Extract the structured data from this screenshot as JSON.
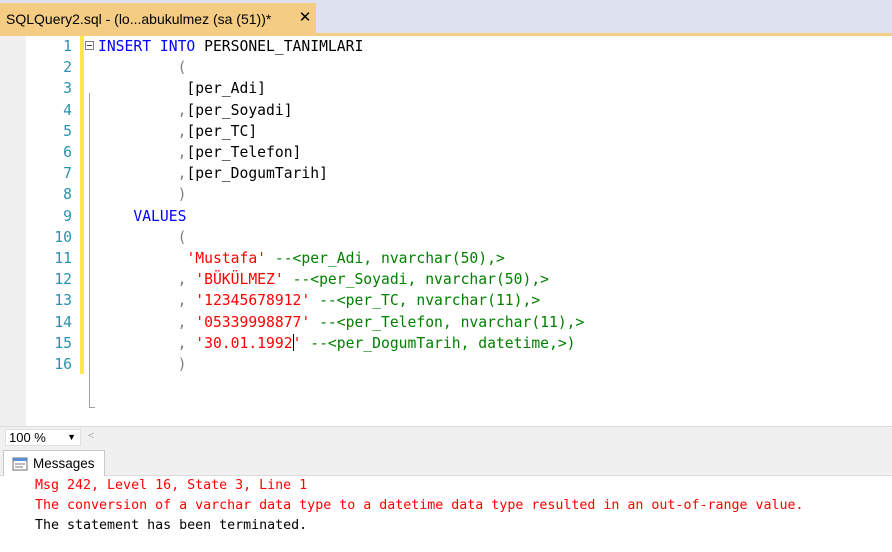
{
  "tab": {
    "title": "SQLQuery2.sql - (lo...abukulmez (sa (51))*",
    "close": "✕"
  },
  "editor": {
    "lines": [
      {
        "n": "1",
        "parts": [
          [
            "kw",
            "INSERT"
          ],
          [
            "plain",
            " "
          ],
          [
            "kw",
            "INTO"
          ],
          [
            "plain",
            " PERSONEL_TANIMLARI"
          ]
        ]
      },
      {
        "n": "2",
        "parts": [
          [
            "plain",
            "         "
          ],
          [
            "gray",
            "("
          ]
        ]
      },
      {
        "n": "3",
        "parts": [
          [
            "plain",
            "          [per_Adi]"
          ]
        ]
      },
      {
        "n": "4",
        "parts": [
          [
            "plain",
            "         "
          ],
          [
            "gray",
            ","
          ],
          [
            "plain",
            "[per_Soyadi]"
          ]
        ]
      },
      {
        "n": "5",
        "parts": [
          [
            "plain",
            "         "
          ],
          [
            "gray",
            ","
          ],
          [
            "plain",
            "[per_TC]"
          ]
        ]
      },
      {
        "n": "6",
        "parts": [
          [
            "plain",
            "         "
          ],
          [
            "gray",
            ","
          ],
          [
            "plain",
            "[per_Telefon]"
          ]
        ]
      },
      {
        "n": "7",
        "parts": [
          [
            "plain",
            "         "
          ],
          [
            "gray",
            ","
          ],
          [
            "plain",
            "[per_DogumTarih]"
          ]
        ]
      },
      {
        "n": "8",
        "parts": [
          [
            "plain",
            "         "
          ],
          [
            "gray",
            ")"
          ]
        ]
      },
      {
        "n": "9",
        "parts": [
          [
            "plain",
            "    "
          ],
          [
            "kw",
            "VALUES"
          ]
        ]
      },
      {
        "n": "10",
        "parts": [
          [
            "plain",
            "         "
          ],
          [
            "gray",
            "("
          ]
        ]
      },
      {
        "n": "11",
        "parts": [
          [
            "plain",
            "          "
          ],
          [
            "str",
            "'Mustafa'"
          ],
          [
            "plain",
            " "
          ],
          [
            "cmt",
            "--<per_Adi, nvarchar(50),>"
          ]
        ]
      },
      {
        "n": "12",
        "parts": [
          [
            "plain",
            "         "
          ],
          [
            "gray",
            ","
          ],
          [
            "plain",
            " "
          ],
          [
            "str",
            "'BÜKÜLMEZ'"
          ],
          [
            "plain",
            " "
          ],
          [
            "cmt",
            "--<per_Soyadi, nvarchar(50),>"
          ]
        ]
      },
      {
        "n": "13",
        "parts": [
          [
            "plain",
            "         "
          ],
          [
            "gray",
            ","
          ],
          [
            "plain",
            " "
          ],
          [
            "str",
            "'12345678912'"
          ],
          [
            "plain",
            " "
          ],
          [
            "cmt",
            "--<per_TC, nvarchar(11),>"
          ]
        ]
      },
      {
        "n": "14",
        "parts": [
          [
            "plain",
            "         "
          ],
          [
            "gray",
            ","
          ],
          [
            "plain",
            " "
          ],
          [
            "str",
            "'05339998877'"
          ],
          [
            "plain",
            " "
          ],
          [
            "cmt",
            "--<per_Telefon, nvarchar(11),>"
          ]
        ]
      },
      {
        "n": "15",
        "parts": [
          [
            "plain",
            "         "
          ],
          [
            "gray",
            ","
          ],
          [
            "plain",
            " "
          ],
          [
            "str",
            "'30.01.1992"
          ],
          [
            "caret",
            ""
          ],
          [
            "str",
            "'"
          ],
          [
            "plain",
            " "
          ],
          [
            "cmt",
            "--<per_DogumTarih, datetime,>)"
          ]
        ]
      },
      {
        "n": "16",
        "parts": [
          [
            "plain",
            "         "
          ],
          [
            "gray",
            ")"
          ]
        ]
      }
    ]
  },
  "zoom": {
    "value": "100 %"
  },
  "results": {
    "tab_label": "Messages",
    "messages": [
      {
        "kind": "err",
        "text": "Msg 242, Level 16, State 3, Line 1"
      },
      {
        "kind": "err",
        "text": "The conversion of a varchar data type to a datetime data type resulted in an out-of-range value."
      },
      {
        "kind": "ok",
        "text": "The statement has been terminated."
      }
    ]
  }
}
